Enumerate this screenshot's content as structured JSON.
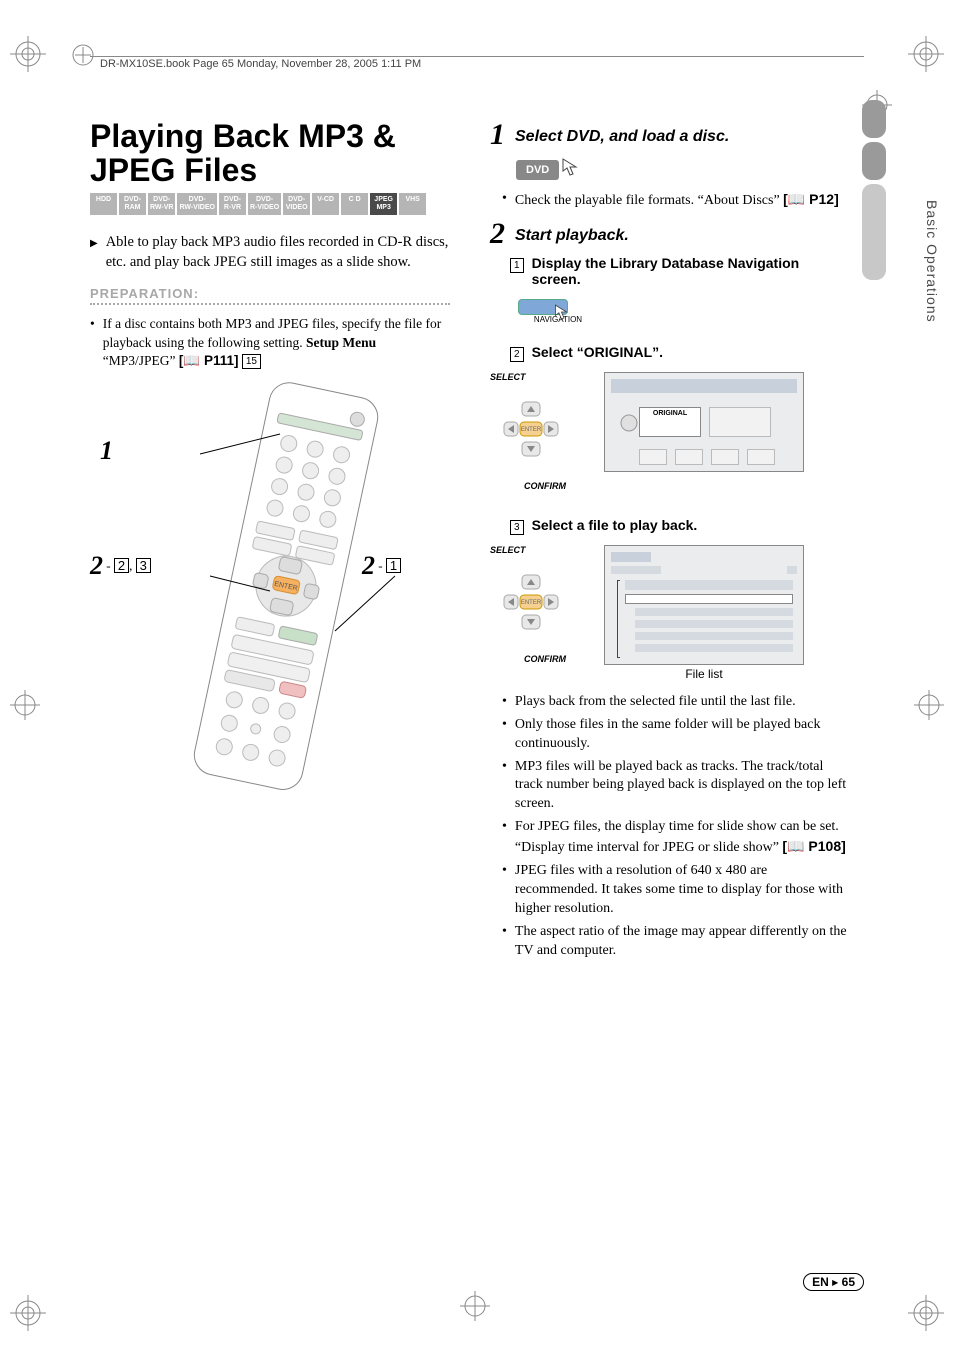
{
  "header": "DR-MX10SE.book  Page 65  Monday, November 28, 2005  1:11 PM",
  "title": "Playing Back MP3 & JPEG Files",
  "format_strip": [
    {
      "label": "HDD",
      "dark": false
    },
    {
      "label": "DVD-\nRAM",
      "dark": false
    },
    {
      "label": "DVD-\nRW-VR",
      "dark": false
    },
    {
      "label": "DVD-\nRW-VIDEO",
      "dark": false
    },
    {
      "label": "DVD-\nR-VR",
      "dark": false
    },
    {
      "label": "DVD-\nR-VIDEO",
      "dark": false
    },
    {
      "label": "DVD-\nVIDEO",
      "dark": false
    },
    {
      "label": "V-CD",
      "dark": false
    },
    {
      "label": "C D",
      "dark": false
    },
    {
      "label": "JPEG\nMP3",
      "dark": true
    },
    {
      "label": "VHS",
      "dark": false
    }
  ],
  "lead": "Able to play back MP3 audio files recorded in CD-R discs, etc. and play back JPEG still images as a slide show.",
  "preparation": {
    "heading": "PREPARATION:",
    "body_pre": "If a disc contains both MP3 and JPEG files, specify the file for playback using the following setting. ",
    "setup_menu": "Setup Menu",
    "body_mid": " “MP3/JPEG” ",
    "ref_label": "P111",
    "num_box": "15"
  },
  "callout_1": "1",
  "callout_2a_num": "2",
  "callout_2a_subs": [
    "2",
    "3"
  ],
  "callout_2b_num": "2",
  "callout_2b_subs": [
    "1"
  ],
  "step1": {
    "num": "1",
    "title": "Select DVD, and load a disc.",
    "pill": "DVD",
    "bullet": "Check the playable file formats. “About Discs” ",
    "ref": "P12"
  },
  "step2": {
    "num": "2",
    "title": "Start playback.",
    "sub1": {
      "box": "1",
      "text": "Display the Library Database Navigation screen."
    },
    "nav_button": "NAVIGATION",
    "sub2": {
      "box": "2",
      "text_pre": "Select “",
      "text_bold": "ORIGINAL",
      "text_post": "”."
    },
    "select_label": "SELECT",
    "confirm_label": "CONFIRM",
    "enter_label": "ENTER",
    "screen2_label": "ORIGINAL",
    "sub3": {
      "box": "3",
      "text": "Select a file to play back."
    },
    "file_list_label": "File list",
    "bullets": [
      "Plays back from the selected file until the last file.",
      "Only those files in the same folder will be played back continuously.",
      "MP3 files will be played back as tracks. The track/total track number being played back is displayed on the top left screen.",
      "For JPEG files, the display time for slide show can be set. “Display time interval for JPEG or slide show” ",
      "JPEG files with a resolution of 640 x 480 are recommended. It takes some time to display for those with higher resolution.",
      "The aspect ratio of the image may appear differently on the TV and computer."
    ],
    "bullet4_ref": "P108"
  },
  "sidebar_text": "Basic Operations",
  "footer": {
    "lang": "EN",
    "page": "65"
  }
}
